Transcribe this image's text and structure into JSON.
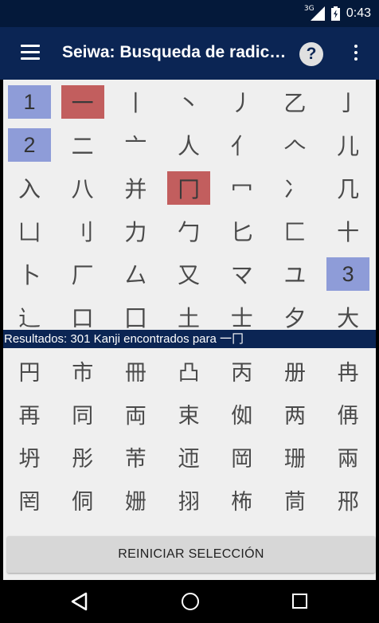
{
  "status_bar": {
    "network": "3G",
    "time": "0:43"
  },
  "app_bar": {
    "title": "Seiwa: Busqueda de radicales"
  },
  "radicals": [
    {
      "char": "1",
      "kind": "num"
    },
    {
      "char": "一",
      "kind": "sel"
    },
    {
      "char": "丨",
      "kind": ""
    },
    {
      "char": "丶",
      "kind": ""
    },
    {
      "char": "丿",
      "kind": ""
    },
    {
      "char": "乙",
      "kind": ""
    },
    {
      "char": "亅",
      "kind": ""
    },
    {
      "char": "2",
      "kind": "num"
    },
    {
      "char": "二",
      "kind": ""
    },
    {
      "char": "亠",
      "kind": ""
    },
    {
      "char": "人",
      "kind": ""
    },
    {
      "char": "亻",
      "kind": ""
    },
    {
      "char": "𠆢",
      "kind": ""
    },
    {
      "char": "儿",
      "kind": ""
    },
    {
      "char": "入",
      "kind": ""
    },
    {
      "char": "八",
      "kind": ""
    },
    {
      "char": "并",
      "kind": ""
    },
    {
      "char": "冂",
      "kind": "sel"
    },
    {
      "char": "冖",
      "kind": ""
    },
    {
      "char": "冫",
      "kind": ""
    },
    {
      "char": "几",
      "kind": ""
    },
    {
      "char": "凵",
      "kind": ""
    },
    {
      "char": "刂",
      "kind": ""
    },
    {
      "char": "力",
      "kind": ""
    },
    {
      "char": "勹",
      "kind": ""
    },
    {
      "char": "匕",
      "kind": ""
    },
    {
      "char": "匚",
      "kind": ""
    },
    {
      "char": "十",
      "kind": ""
    },
    {
      "char": "卜",
      "kind": ""
    },
    {
      "char": "厂",
      "kind": ""
    },
    {
      "char": "厶",
      "kind": ""
    },
    {
      "char": "又",
      "kind": ""
    },
    {
      "char": "マ",
      "kind": ""
    },
    {
      "char": "ユ",
      "kind": ""
    },
    {
      "char": "3",
      "kind": "num"
    },
    {
      "char": "辶",
      "kind": ""
    },
    {
      "char": "口",
      "kind": ""
    },
    {
      "char": "囗",
      "kind": ""
    },
    {
      "char": "土",
      "kind": ""
    },
    {
      "char": "士",
      "kind": ""
    },
    {
      "char": "夕",
      "kind": ""
    },
    {
      "char": "大",
      "kind": ""
    }
  ],
  "results": {
    "text": "Resultados: 301 Kanji encontrados para 一冂"
  },
  "kanji": [
    "円",
    "市",
    "冊",
    "凸",
    "丙",
    "册",
    "冉",
    "再",
    "同",
    "両",
    "束",
    "侞",
    "两",
    "侢",
    "坍",
    "彤",
    "芾",
    "迊",
    "岡",
    "珊",
    "兩",
    "罔",
    "侗",
    "姗",
    "挧",
    "柨",
    "茼",
    "郉"
  ],
  "reset_button": {
    "label": "REINICIAR SELECCIÓN"
  }
}
